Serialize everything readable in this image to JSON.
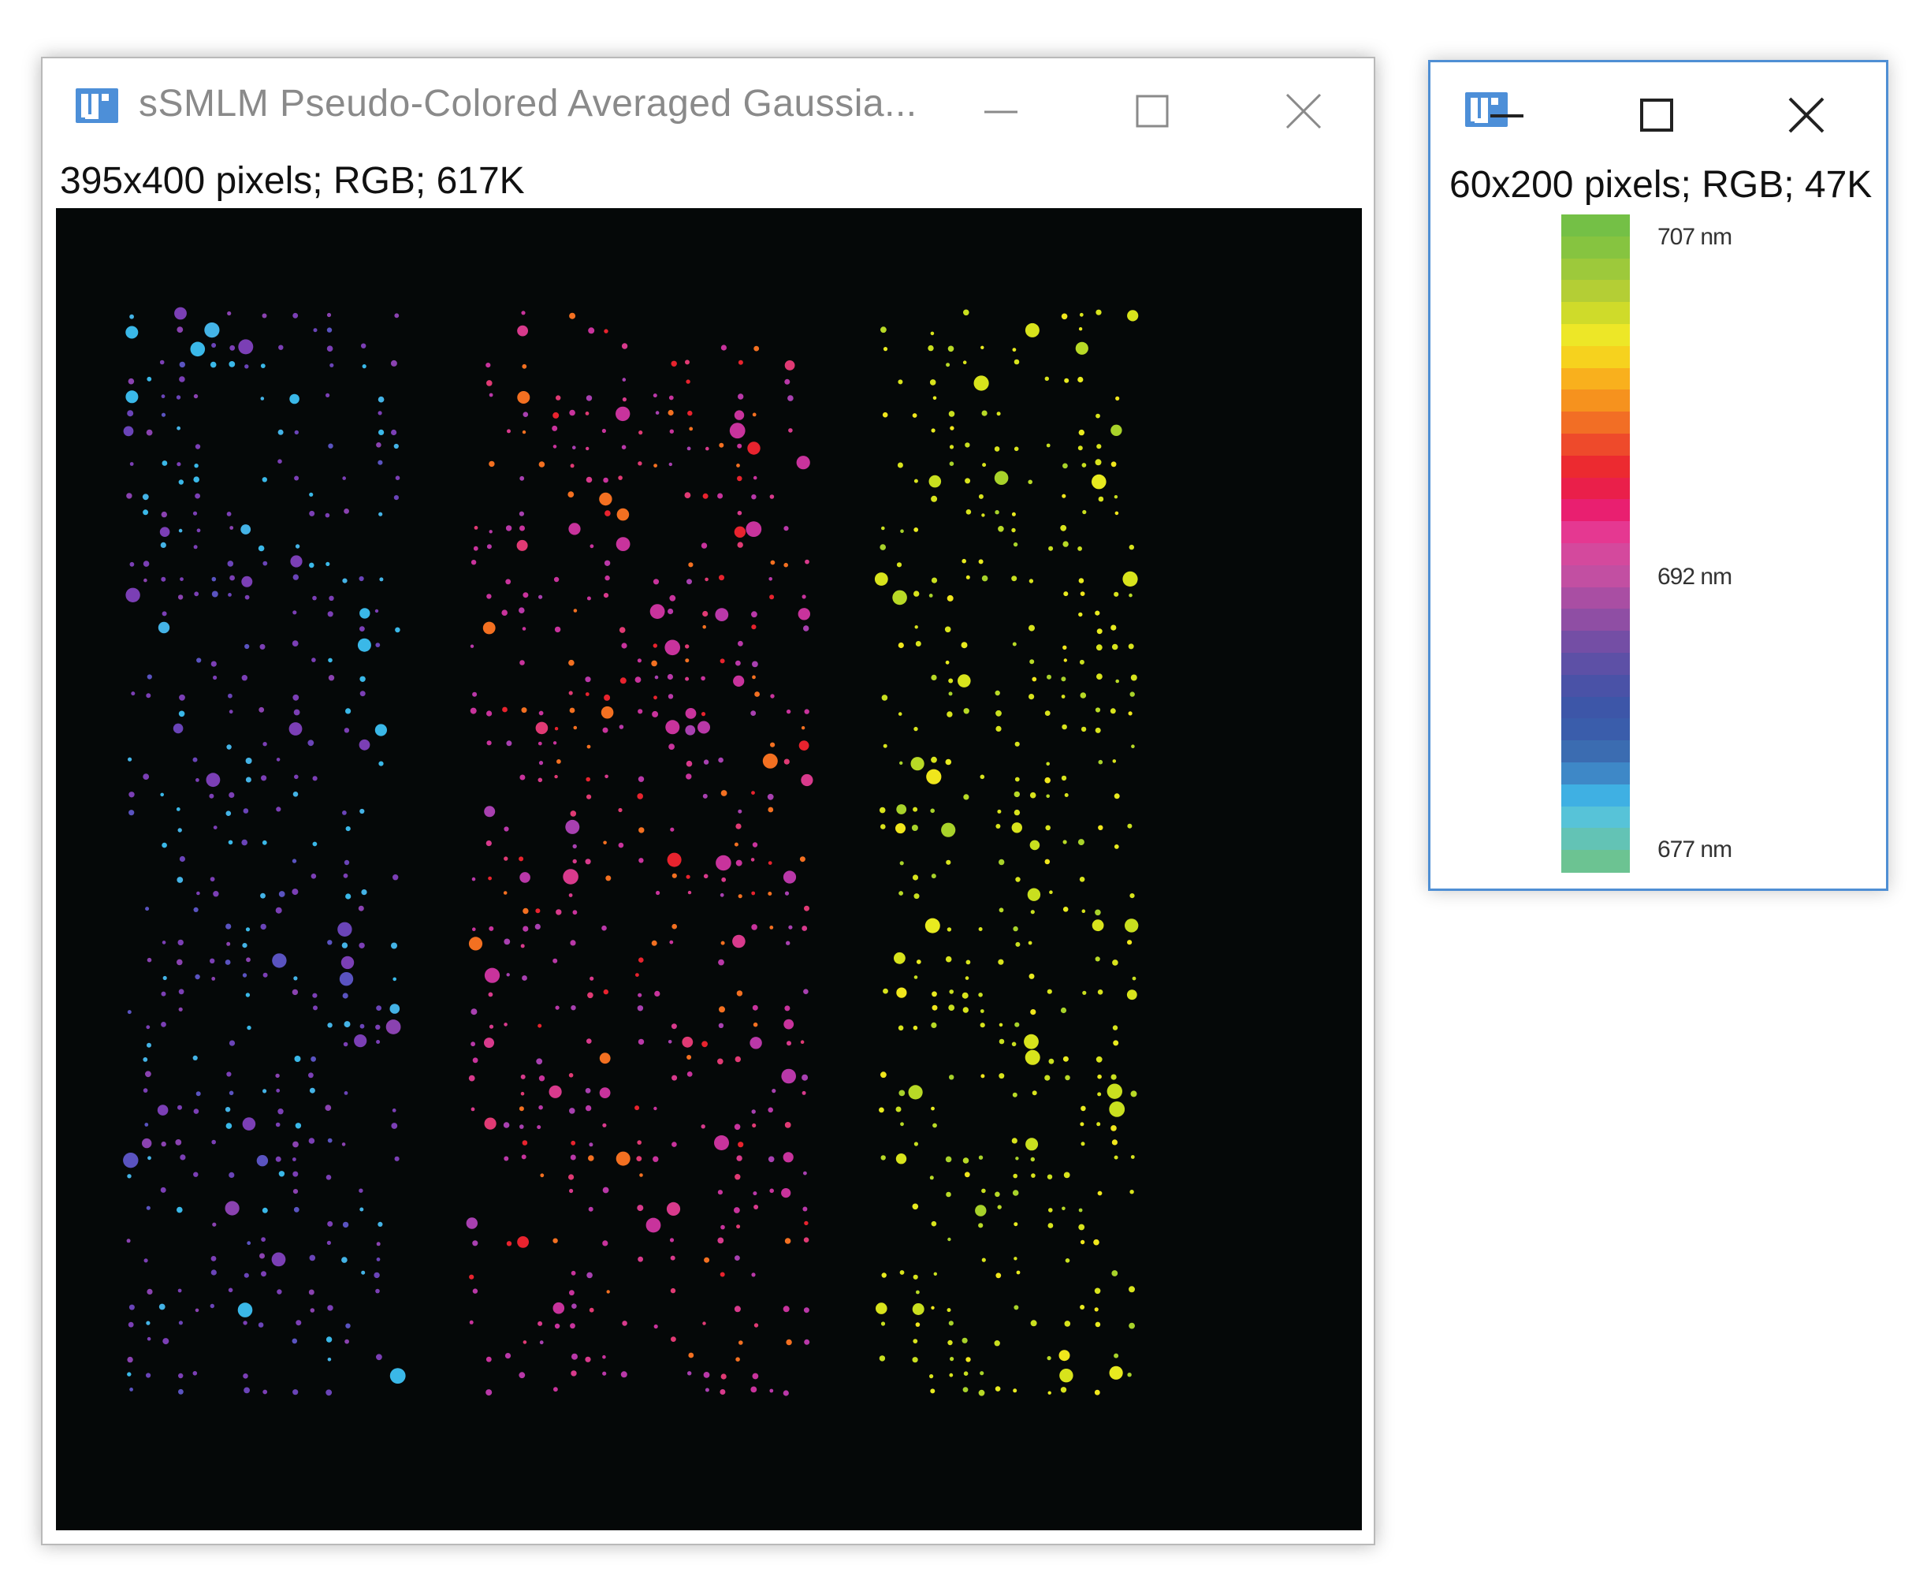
{
  "main_window": {
    "title": "sSMLM Pseudo-Colored Averaged Gaussia...",
    "info": "395x400 pixels; RGB; 617K",
    "icon": "imagej-icon",
    "controls": [
      "minimize-icon",
      "maximize-icon",
      "close-icon"
    ]
  },
  "legend_window": {
    "info": "60x200 pixels; RGB; 47K",
    "icon": "imagej-icon",
    "controls": [
      "minimize-icon",
      "maximize-icon",
      "close-icon"
    ],
    "colorbar": {
      "colors_top_to_bottom": [
        "#74c046",
        "#86c440",
        "#9dc93b",
        "#b4ce35",
        "#cfdb2a",
        "#ede727",
        "#f6d21e",
        "#f9b01d",
        "#f6921e",
        "#f26e25",
        "#ee4a2b",
        "#ec2a30",
        "#ea1f4a",
        "#e91f70",
        "#e53891",
        "#d4499d",
        "#c24fa2",
        "#a94ea3",
        "#8f4ea4",
        "#744ea5",
        "#5d50a6",
        "#4a52a7",
        "#3d56a8",
        "#3a5dab",
        "#3b6cb1",
        "#3e88c7",
        "#3fb0e3",
        "#57c3d8",
        "#63c3b5",
        "#6cc392"
      ],
      "ticks": [
        {
          "label": "707 nm",
          "value": 707
        },
        {
          "label": "692 nm",
          "value": 692
        },
        {
          "label": "677 nm",
          "value": 677
        }
      ]
    }
  }
}
